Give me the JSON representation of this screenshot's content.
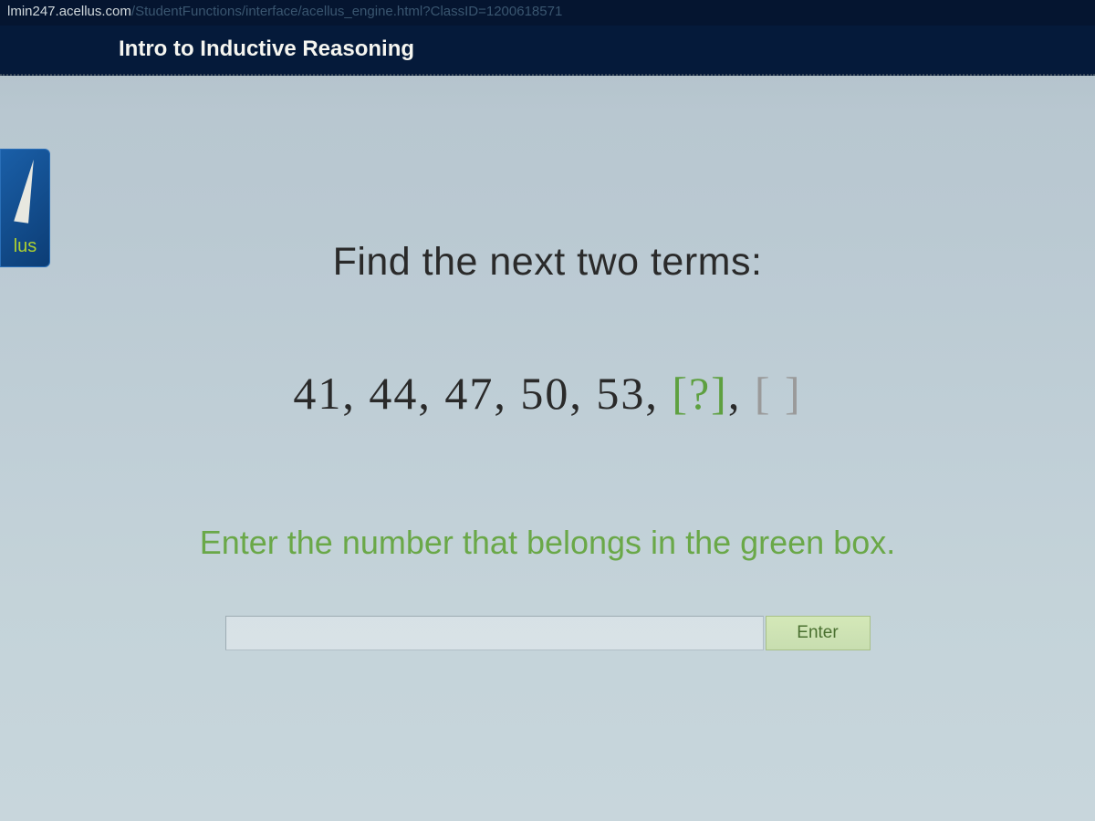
{
  "url": {
    "domain": "lmin247.acellus.com",
    "path": "/StudentFunctions/interface/acellus_engine.html?ClassID=1200618571"
  },
  "header": {
    "title": "Intro to Inductive Reasoning"
  },
  "logo": {
    "text": "lus"
  },
  "problem": {
    "prompt": "Find the next two terms:",
    "sequence_known": "41,  44,  47,  50,  53,  ",
    "sequence_active_blank": "[?]",
    "sequence_separator": ", ",
    "sequence_next_blank": "[  ]",
    "instruction": "Enter the number that belongs in the green box."
  },
  "controls": {
    "answer_value": "",
    "enter_label": "Enter"
  },
  "colors": {
    "background_dark": "#051530",
    "title_text": "#f5f5f0",
    "accent_green": "#6aa848",
    "logo_green": "#aed030",
    "button_bg": "#d4e8b8"
  }
}
